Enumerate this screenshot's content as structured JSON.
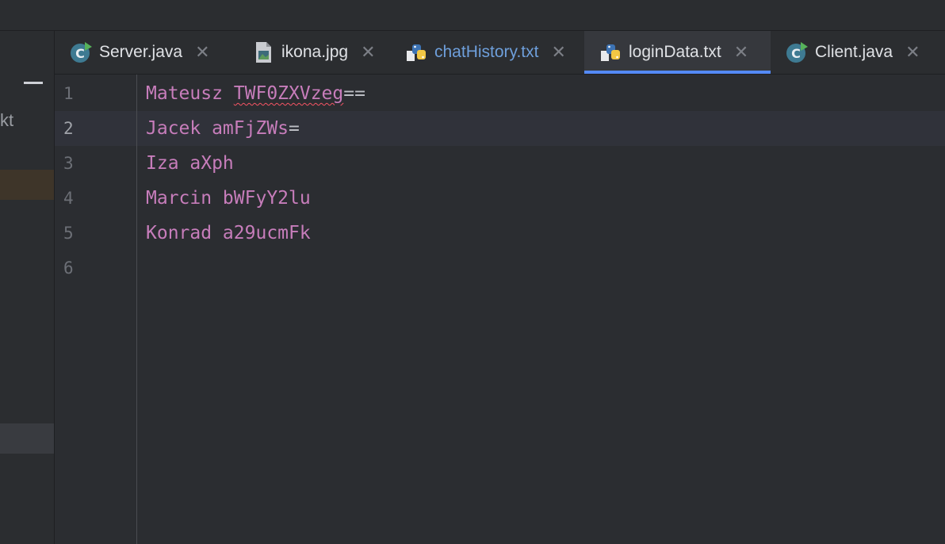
{
  "left_panel": {
    "partial_label": "kt"
  },
  "tabs": [
    {
      "label": "Server.java",
      "icon": "java-class-icon",
      "active": false,
      "modified": false
    },
    {
      "label": "ikona.jpg",
      "icon": "image-file-icon",
      "active": false,
      "modified": false
    },
    {
      "label": "chatHistory.txt",
      "icon": "python-text-file-icon",
      "active": false,
      "modified": true
    },
    {
      "label": "loginData.txt",
      "icon": "python-text-file-icon",
      "active": true,
      "modified": false
    },
    {
      "label": "Client.java",
      "icon": "java-class-icon",
      "active": false,
      "modified": false
    }
  ],
  "close_glyph": "✕",
  "editor": {
    "lines": [
      {
        "number": "1",
        "name": "Mateusz ",
        "secret": "TWF0ZXVzeg",
        "suffix": "=="
      },
      {
        "number": "2",
        "name": "Jacek amFjZWs",
        "secret": "",
        "suffix": "="
      },
      {
        "number": "3",
        "name": "Iza aXph",
        "secret": "",
        "suffix": ""
      },
      {
        "number": "4",
        "name": "Marcin bWFyY2lu",
        "secret": "",
        "suffix": ""
      },
      {
        "number": "5",
        "name": "Konrad a29ucmFk",
        "secret": "",
        "suffix": ""
      },
      {
        "number": "6",
        "name": "",
        "secret": "",
        "suffix": ""
      }
    ],
    "current_line": 2
  },
  "colors": {
    "accent": "#548af7",
    "text_purple": "#c77dbb",
    "modified_tab": "#6e9fdb",
    "error_squiggle": "#f75464"
  }
}
